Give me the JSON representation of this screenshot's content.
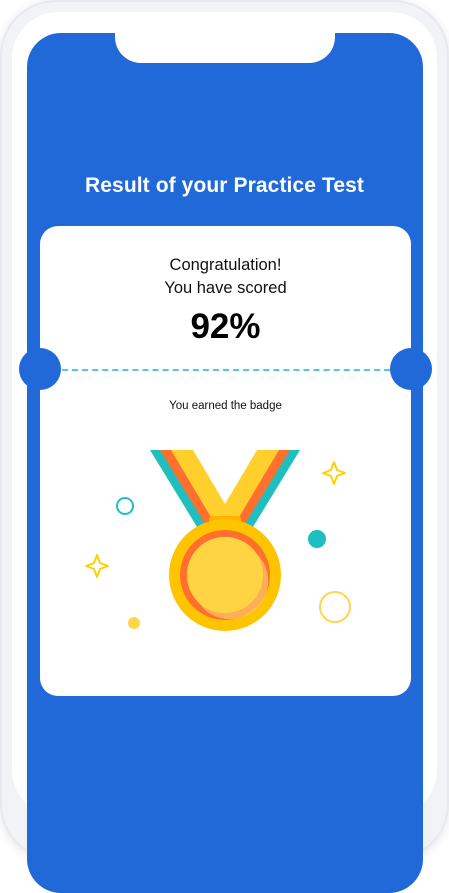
{
  "screen": {
    "title": "Result of your Practice Test",
    "congrats_line1": "Congratulation!",
    "congrats_line2": "You have scored",
    "score": "92%",
    "badge_text": "You earned the badge"
  },
  "colors": {
    "screen_blue": "#2169d8",
    "dashed_line": "#58c4df",
    "medal_gold": "#ffc400",
    "medal_orange": "#ff6f2e",
    "ribbon_teal": "#1fbfbf",
    "ribbon_yellow": "#ffcf2e"
  },
  "icons": {
    "badge": "medal-icon",
    "decor": [
      "sparkle-icon",
      "circle-icon"
    ]
  }
}
